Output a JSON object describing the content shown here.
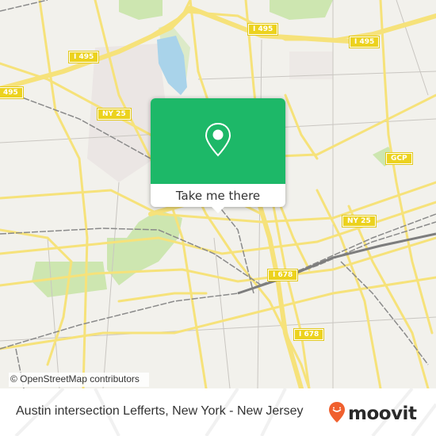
{
  "map": {
    "attribution": "© OpenStreetMap contributors",
    "colors": {
      "land": "#f2f1ec",
      "road": "#f6e27a",
      "road_casing": "#e9cf4c",
      "park": "#cde6b0",
      "water": "#a9d3ea",
      "rail": "#8a8a8a",
      "built": "#ebe6e4",
      "minor_road": "#c9c6c1"
    },
    "shields": [
      {
        "label": "I 495",
        "id": "i495-west"
      },
      {
        "label": "495",
        "id": "i495-edge"
      },
      {
        "label": "I 495",
        "id": "i495-center"
      },
      {
        "label": "I 495",
        "id": "i495-east"
      },
      {
        "label": "NY 25",
        "id": "ny25-west"
      },
      {
        "label": "GCP",
        "id": "gcp"
      },
      {
        "label": "NY 25",
        "id": "ny25-east"
      },
      {
        "label": "I 678",
        "id": "i678-north"
      },
      {
        "label": "I 678",
        "id": "i678-south"
      }
    ]
  },
  "popup": {
    "icon": "map-pin-icon",
    "button_label": "Take me there",
    "accent": "#1db868"
  },
  "footer": {
    "title": "Austin intersection Lefferts, New York - New Jersey",
    "brand": "moovit",
    "brand_color": "#f0602e"
  }
}
